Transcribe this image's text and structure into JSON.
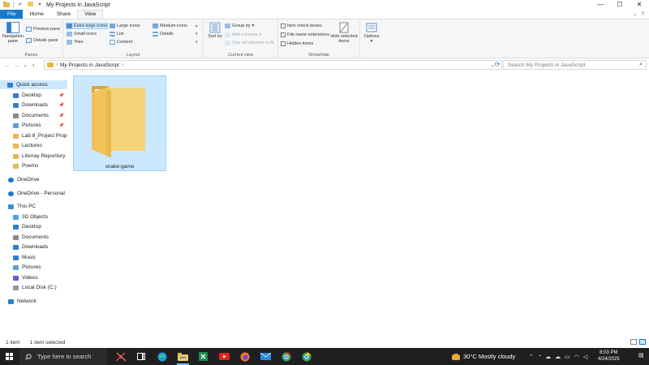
{
  "window": {
    "title": "My Projects in JavaScript",
    "controls": {
      "minimize": "—",
      "maximize": "☐",
      "close": "✕"
    }
  },
  "ribbon_tabs": [
    {
      "label": "File"
    },
    {
      "label": "Home"
    },
    {
      "label": "Share"
    },
    {
      "label": "View"
    }
  ],
  "ribbon": {
    "panes": {
      "navigation_pane": "Navigation pane",
      "preview_pane": "Preview pane",
      "details_pane": "Details pane",
      "label": "Panes"
    },
    "layout": {
      "extra_large_icons": "Extra large icons",
      "large_icons": "Large icons",
      "medium_icons": "Medium icons",
      "small_icons": "Small icons",
      "list": "List",
      "details": "Details",
      "tiles": "Tiles",
      "content": "Content",
      "label": "Layout",
      "selected": "Extra large icons"
    },
    "current_view": {
      "sort_by": "Sort by",
      "group_by": "Group by",
      "add_columns": "Add columns",
      "size_all_columns": "Size all columns to fit",
      "label": "Current view"
    },
    "show_hide": {
      "item_check_boxes": "Item check boxes",
      "file_name_extensions": "File name extensions",
      "hidden_items": "Hidden items",
      "hide_selected_items": "Hide selected items",
      "label": "Show/hide"
    },
    "options": "Options"
  },
  "address": {
    "path": [
      "My Projects in JavaScript"
    ],
    "search_placeholder": "Search My Projects in JavaScript"
  },
  "nav": {
    "items": [
      {
        "label": "Quick access",
        "type": "star",
        "selected": true,
        "indent": 0
      },
      {
        "label": "Desktop",
        "type": "desktop",
        "pinned": true,
        "indent": 1
      },
      {
        "label": "Downloads",
        "type": "download",
        "pinned": true,
        "indent": 1
      },
      {
        "label": "Documents",
        "type": "docs",
        "pinned": true,
        "indent": 1
      },
      {
        "label": "Pictures",
        "type": "pics",
        "pinned": true,
        "indent": 1
      },
      {
        "label": "Lab 8_Project Propc",
        "type": "folder",
        "indent": 1
      },
      {
        "label": "Lectures",
        "type": "folder",
        "indent": 1
      },
      {
        "label": "Literray Reporitory",
        "type": "folder",
        "indent": 1
      },
      {
        "label": "Poems",
        "type": "folder",
        "indent": 1
      },
      {
        "label": "OneDrive",
        "type": "cloud",
        "indent": 0
      },
      {
        "label": "OneDrive - Personal",
        "type": "cloud",
        "indent": 0
      },
      {
        "label": "This PC",
        "type": "pc",
        "indent": 0
      },
      {
        "label": "3D Objects",
        "type": "3d",
        "indent": 1
      },
      {
        "label": "Desktop",
        "type": "desktop",
        "indent": 1
      },
      {
        "label": "Documents",
        "type": "docs",
        "indent": 1
      },
      {
        "label": "Downloads",
        "type": "download",
        "indent": 1
      },
      {
        "label": "Music",
        "type": "music",
        "indent": 1
      },
      {
        "label": "Pictures",
        "type": "pics",
        "indent": 1
      },
      {
        "label": "Videos",
        "type": "video",
        "indent": 1
      },
      {
        "label": "Local Disk (C:)",
        "type": "disk",
        "indent": 1
      },
      {
        "label": "Network",
        "type": "network",
        "indent": 0
      }
    ]
  },
  "content": {
    "items": [
      {
        "name": "snake-game",
        "type": "folder",
        "selected": true
      }
    ]
  },
  "status": {
    "count": "1 item",
    "selected": "1 item selected"
  },
  "taskbar": {
    "search_placeholder": "Type here to search",
    "weather": "30°C  Mostly cloudy",
    "time": "8:03 PM",
    "date": "4/24/2025",
    "apps": [
      "pool-app-icon",
      "task-view-icon",
      "edge-icon",
      "file-explorer-icon",
      "excel-icon",
      "youtube-icon",
      "firefox-icon",
      "mail-icon",
      "chrome-icon",
      "chrome-profile-icon"
    ]
  },
  "colors": {
    "accent": "#1979ca",
    "selection": "#cce8ff",
    "folder": "#e8b94a",
    "taskbar": "#1f1f22"
  }
}
